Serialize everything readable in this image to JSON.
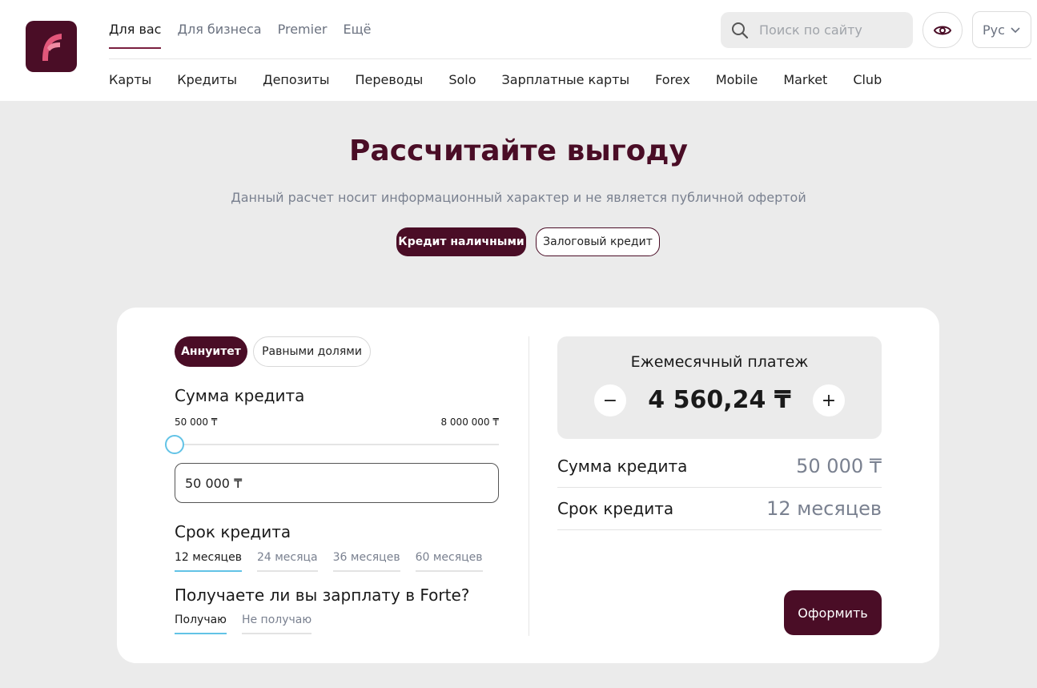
{
  "header": {
    "top_nav": [
      {
        "label": "Для вас",
        "active": true
      },
      {
        "label": "Для бизнеса",
        "active": false
      },
      {
        "label": "Premier",
        "active": false
      },
      {
        "label": "Ещё",
        "active": false
      }
    ],
    "search": {
      "placeholder": "Поиск по сайту",
      "icon": "search-icon"
    },
    "visibility_icon": "eye-icon",
    "language": {
      "selected": "Рус",
      "icon": "chevron-down-icon"
    },
    "sub_nav": [
      "Карты",
      "Кредиты",
      "Депозиты",
      "Переводы",
      "Solo",
      "Зарплатные карты",
      "Forex",
      "Mobile",
      "Market",
      "Club"
    ]
  },
  "hero": {
    "title": "Рассчитайте выгоду",
    "subtitle": "Данный расчет носит информационный характер и не является публичной офертой",
    "product_tabs": [
      "Кредит наличными",
      "Залоговый кредит"
    ],
    "active_product_tab": "Кредит наличными"
  },
  "calculator": {
    "payment_type_tabs": [
      "Аннуитет",
      "Равными долями"
    ],
    "active_payment_type": "Аннуитет",
    "amount": {
      "title": "Сумма кредита",
      "min_label": "50 000 ₸",
      "max_label": "8 000 000 ₸",
      "min": 50000,
      "max": 8000000,
      "value": 50000,
      "input_value": "50 000 ₸"
    },
    "term": {
      "title": "Срок кредита",
      "options": [
        "12 месяцев",
        "24 месяца",
        "36 месяцев",
        "60 месяцев"
      ],
      "selected": "12 месяцев"
    },
    "salary": {
      "title": "Получаете ли вы зарплату в Forte?",
      "options": [
        "Получаю",
        "Не получаю"
      ],
      "selected": "Получаю"
    }
  },
  "result": {
    "monthly_title": "Ежемесячный платеж",
    "monthly_value": "4 560,24 ₸",
    "minus": "−",
    "plus": "+",
    "rows": [
      {
        "label": "Сумма кредита",
        "value": "50 000 ₸"
      },
      {
        "label": "Срок кредита",
        "value": "12 месяцев"
      }
    ],
    "apply_label": "Оформить"
  },
  "colors": {
    "brand": "#4a0d26",
    "accent": "#62c3e6",
    "background": "#ebebeb"
  }
}
